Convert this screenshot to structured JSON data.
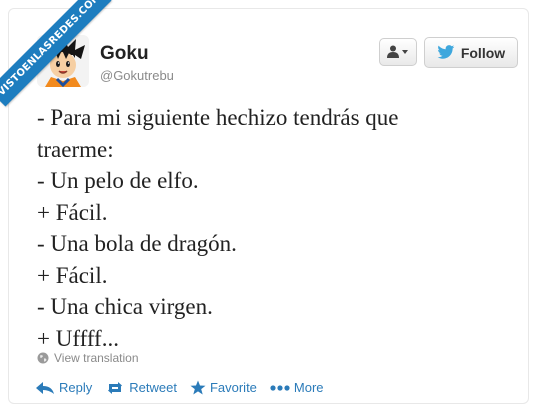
{
  "watermark": {
    "text": "VISTOENLASREDES.COM"
  },
  "author": {
    "name": "Goku",
    "handle": "@Gokutrebu",
    "avatar_icon": "goku-avatar"
  },
  "header": {
    "user_menu_icon": "person-dropdown-icon",
    "follow_label": "Follow",
    "follow_icon": "twitter-bird-icon"
  },
  "tweet": {
    "lines": [
      "- Para mi siguiente hechizo tendrás que",
      "traerme:",
      "- Un pelo de elfo.",
      "+ Fácil.",
      "- Una bola de dragón.",
      "+ Fácil.",
      "- Una chica virgen.",
      "+ Uffff..."
    ]
  },
  "translation": {
    "label": "View translation",
    "icon": "globe-icon"
  },
  "actions": [
    {
      "label": "Reply",
      "icon": "reply-icon"
    },
    {
      "label": "Retweet",
      "icon": "retweet-icon"
    },
    {
      "label": "Favorite",
      "icon": "star-icon"
    },
    {
      "label": "More",
      "icon": "more-dots-icon"
    }
  ],
  "colors": {
    "accent": "#2b7bb9",
    "twitter_bird": "#3ea7dd",
    "ribbon": "#1d7dbf",
    "text": "#222222",
    "muted": "#8a8a8a"
  }
}
